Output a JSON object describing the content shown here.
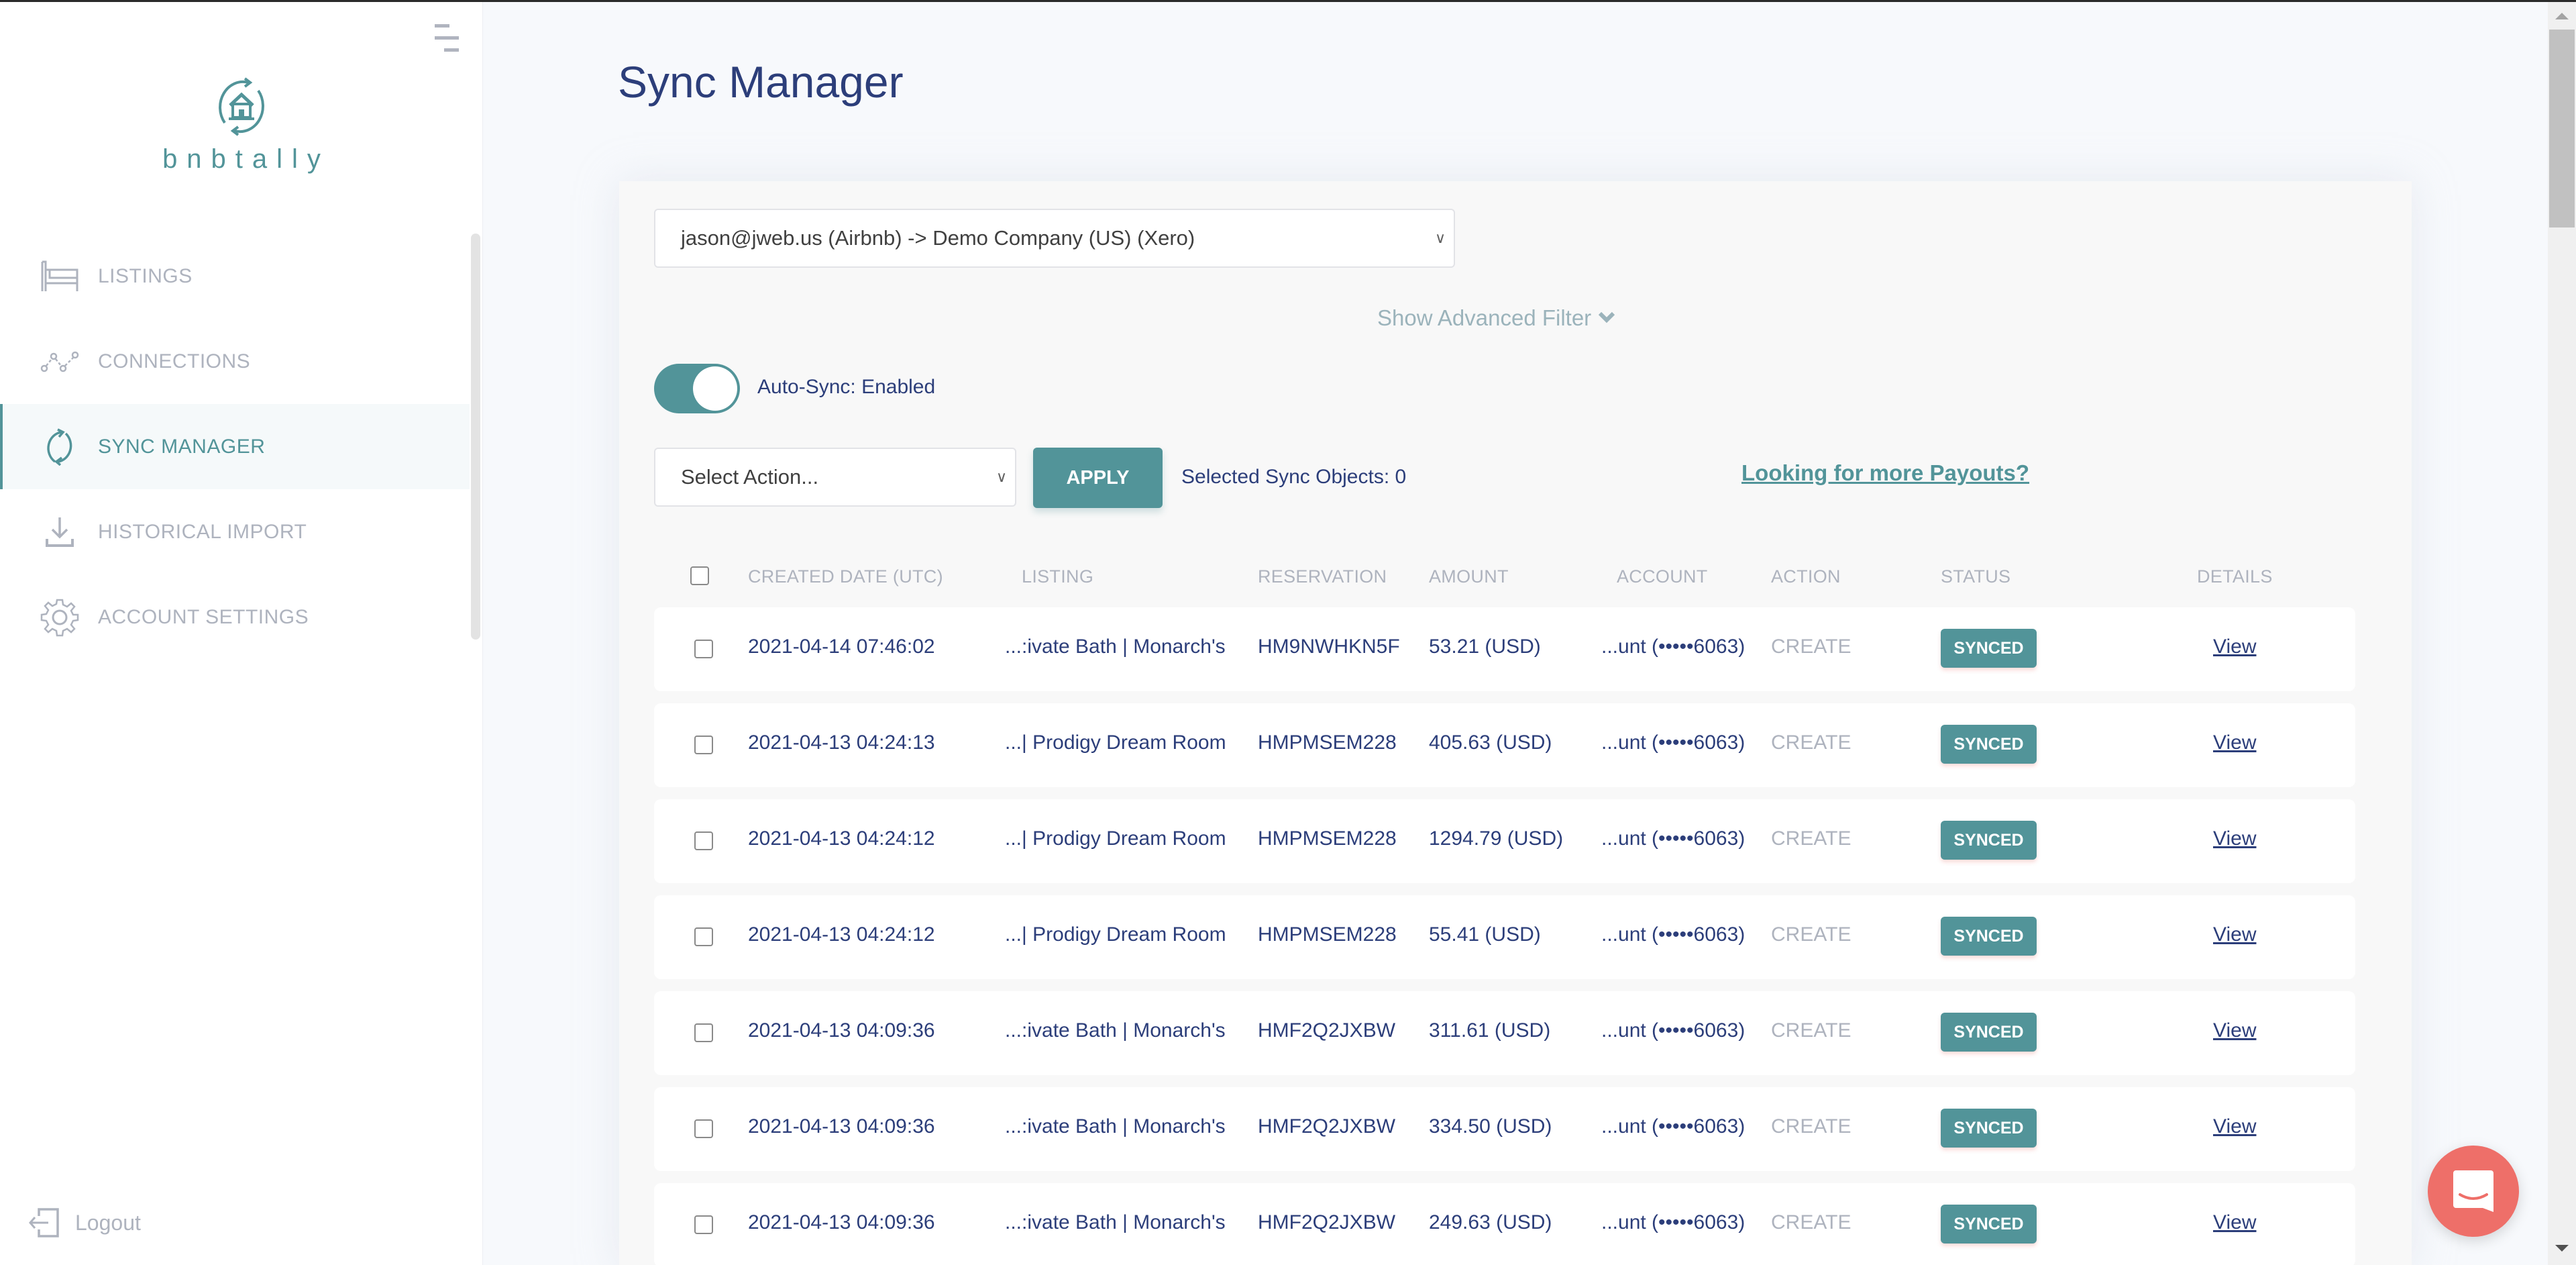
{
  "app": {
    "brand": "bnbtally",
    "accent_color": "#529499",
    "title_color": "#2c3e7a"
  },
  "sidebar": {
    "items": [
      {
        "label": "LISTINGS",
        "icon": "bed-icon",
        "active": false
      },
      {
        "label": "CONNECTIONS",
        "icon": "connections-icon",
        "active": false
      },
      {
        "label": "SYNC MANAGER",
        "icon": "sync-icon",
        "active": true
      },
      {
        "label": "HISTORICAL IMPORT",
        "icon": "download-icon",
        "active": false
      },
      {
        "label": "ACCOUNT SETTINGS",
        "icon": "gear-icon",
        "active": false
      }
    ],
    "logout_label": "Logout"
  },
  "page": {
    "title": "Sync Manager"
  },
  "filters": {
    "connection_value": "jason@jweb.us (Airbnb) -> Demo Company (US) (Xero)",
    "advanced_filter_label": "Show Advanced Filter",
    "auto_sync_label": "Auto-Sync: Enabled",
    "auto_sync_enabled": true,
    "action_placeholder": "Select Action...",
    "apply_label": "APPLY",
    "selected_count_label": "Selected Sync Objects: 0",
    "payouts_link": "Looking for more Payouts?"
  },
  "table": {
    "columns": [
      "CREATED DATE (UTC)",
      "LISTING",
      "RESERVATION",
      "AMOUNT",
      "ACCOUNT",
      "ACTION",
      "STATUS",
      "DETAILS"
    ],
    "rows": [
      {
        "date": "2021-04-14 07:46:02",
        "listing": "...:ivate Bath | Monarch's",
        "reservation": "HM9NWHKN5F",
        "amount": "53.21 (USD)",
        "account": "...unt (•••••6063)",
        "action": "CREATE",
        "status": "SYNCED",
        "details": "View"
      },
      {
        "date": "2021-04-13 04:24:13",
        "listing": "...| Prodigy Dream Room",
        "reservation": "HMPMSEM228",
        "amount": "405.63 (USD)",
        "account": "...unt (•••••6063)",
        "action": "CREATE",
        "status": "SYNCED",
        "details": "View"
      },
      {
        "date": "2021-04-13 04:24:12",
        "listing": "...| Prodigy Dream Room",
        "reservation": "HMPMSEM228",
        "amount": "1294.79 (USD)",
        "account": "...unt (•••••6063)",
        "action": "CREATE",
        "status": "SYNCED",
        "details": "View"
      },
      {
        "date": "2021-04-13 04:24:12",
        "listing": "...| Prodigy Dream Room",
        "reservation": "HMPMSEM228",
        "amount": "55.41 (USD)",
        "account": "...unt (•••••6063)",
        "action": "CREATE",
        "status": "SYNCED",
        "details": "View"
      },
      {
        "date": "2021-04-13 04:09:36",
        "listing": "...:ivate Bath | Monarch's",
        "reservation": "HMF2Q2JXBW",
        "amount": "311.61 (USD)",
        "account": "...unt (•••••6063)",
        "action": "CREATE",
        "status": "SYNCED",
        "details": "View"
      },
      {
        "date": "2021-04-13 04:09:36",
        "listing": "...:ivate Bath | Monarch's",
        "reservation": "HMF2Q2JXBW",
        "amount": "334.50 (USD)",
        "account": "...unt (•••••6063)",
        "action": "CREATE",
        "status": "SYNCED",
        "details": "View"
      },
      {
        "date": "2021-04-13 04:09:36",
        "listing": "...:ivate Bath | Monarch's",
        "reservation": "HMF2Q2JXBW",
        "amount": "249.63 (USD)",
        "account": "...unt (•••••6063)",
        "action": "CREATE",
        "status": "SYNCED",
        "details": "View"
      }
    ]
  },
  "chat": {
    "icon": "chat-icon",
    "color": "#ee6f69"
  }
}
